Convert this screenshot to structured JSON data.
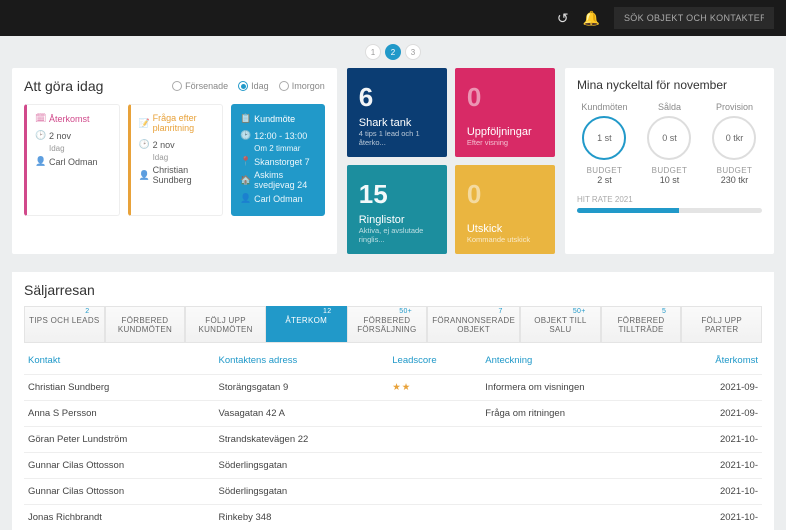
{
  "topbar": {
    "search_placeholder": "SÖK OBJEKT OCH KONTAKTER"
  },
  "pager": {
    "p1": "1",
    "p2": "2",
    "p3": "3"
  },
  "todo": {
    "title": "Att göra idag",
    "filters": {
      "a": "Försenade",
      "b": "Idag",
      "c": "Imorgon"
    },
    "c1": {
      "title": "Återkomst",
      "date": "2 nov",
      "day": "Idag",
      "person": "Carl Odman"
    },
    "c2": {
      "title": "Fråga efter planritning",
      "date": "2 nov",
      "day": "Idag",
      "person": "Christian Sundberg"
    },
    "c3": {
      "title": "Kundmöte",
      "time": "12:00 - 13:00",
      "rel": "Om 2 timmar",
      "addr1": "Skanstorget 7",
      "addr2": "Askims svedjevag 24",
      "person": "Carl Odman"
    }
  },
  "tiles": {
    "a": {
      "num": "6",
      "lbl": "Shark tank",
      "sub": "4 tips 1 lead och 1 återko..."
    },
    "b": {
      "num": "0",
      "lbl": "Uppföljningar",
      "sub": "Efter visning"
    },
    "c": {
      "num": "15",
      "lbl": "Ringlistor",
      "sub": "Aktiva, ej avslutade ringlis..."
    },
    "d": {
      "num": "0",
      "lbl": "Utskick",
      "sub": "Kommande utskick"
    }
  },
  "kpi": {
    "title": "Mina nyckeltal för november",
    "r1": {
      "cap": "Kundmöten",
      "val": "1 st",
      "budget_lbl": "BUDGET",
      "budget": "2 st"
    },
    "r2": {
      "cap": "Sålda",
      "val": "0 st",
      "budget_lbl": "BUDGET",
      "budget": "10 st"
    },
    "r3": {
      "cap": "Provision",
      "val": "0 tkr",
      "budget_lbl": "BUDGET",
      "budget": "230 tkr"
    },
    "hit_label": "HIT RATE 2021"
  },
  "journey": {
    "title": "Säljarresan",
    "tabs": {
      "t1": {
        "label": "TIPS OCH LEADS",
        "badge": "2"
      },
      "t2": {
        "label": "FÖRBERED KUNDMÖTEN",
        "badge": ""
      },
      "t3": {
        "label": "FÖLJ UPP KUNDMÖTEN",
        "badge": ""
      },
      "t4": {
        "label": "ÅTERKOM",
        "badge": "12"
      },
      "t5": {
        "label": "FÖRBERED FÖRSÄLJNING",
        "badge": "50+"
      },
      "t6": {
        "label": "FÖRANNONSERADE OBJEKT",
        "badge": "7"
      },
      "t7": {
        "label": "OBJEKT TILL SALU",
        "badge": "50+"
      },
      "t8": {
        "label": "FÖRBERED TILLTRÄDE",
        "badge": "5"
      },
      "t9": {
        "label": "FÖLJ UPP PARTER",
        "badge": ""
      }
    },
    "headers": {
      "h1": "Kontakt",
      "h2": "Kontaktens adress",
      "h3": "Leadscore",
      "h4": "Anteckning",
      "h5": "Återkomst"
    },
    "rows": {
      "r1": {
        "c1": "Christian Sundberg",
        "c2": "Storängsgatan 9",
        "c3": "★★",
        "c4": "Informera om visningen",
        "c5": "2021-09-"
      },
      "r2": {
        "c1": "Anna S Persson",
        "c2": "Vasagatan 42 A",
        "c3": "",
        "c4": "Fråga om ritningen",
        "c5": "2021-09-"
      },
      "r3": {
        "c1": "Göran Peter Lundström",
        "c2": "Strandskatevägen 22",
        "c3": "",
        "c4": "",
        "c5": "2021-10-"
      },
      "r4": {
        "c1": "Gunnar Cilas Ottosson",
        "c2": "Söderlingsgatan",
        "c3": "",
        "c4": "",
        "c5": "2021-10-"
      },
      "r5": {
        "c1": "Gunnar Cilas Ottosson",
        "c2": "Söderlingsgatan",
        "c3": "",
        "c4": "",
        "c5": "2021-10-"
      },
      "r6": {
        "c1": "Jonas Richbrandt",
        "c2": "Rinkeby 348",
        "c3": "",
        "c4": "",
        "c5": "2021-10-"
      }
    }
  }
}
